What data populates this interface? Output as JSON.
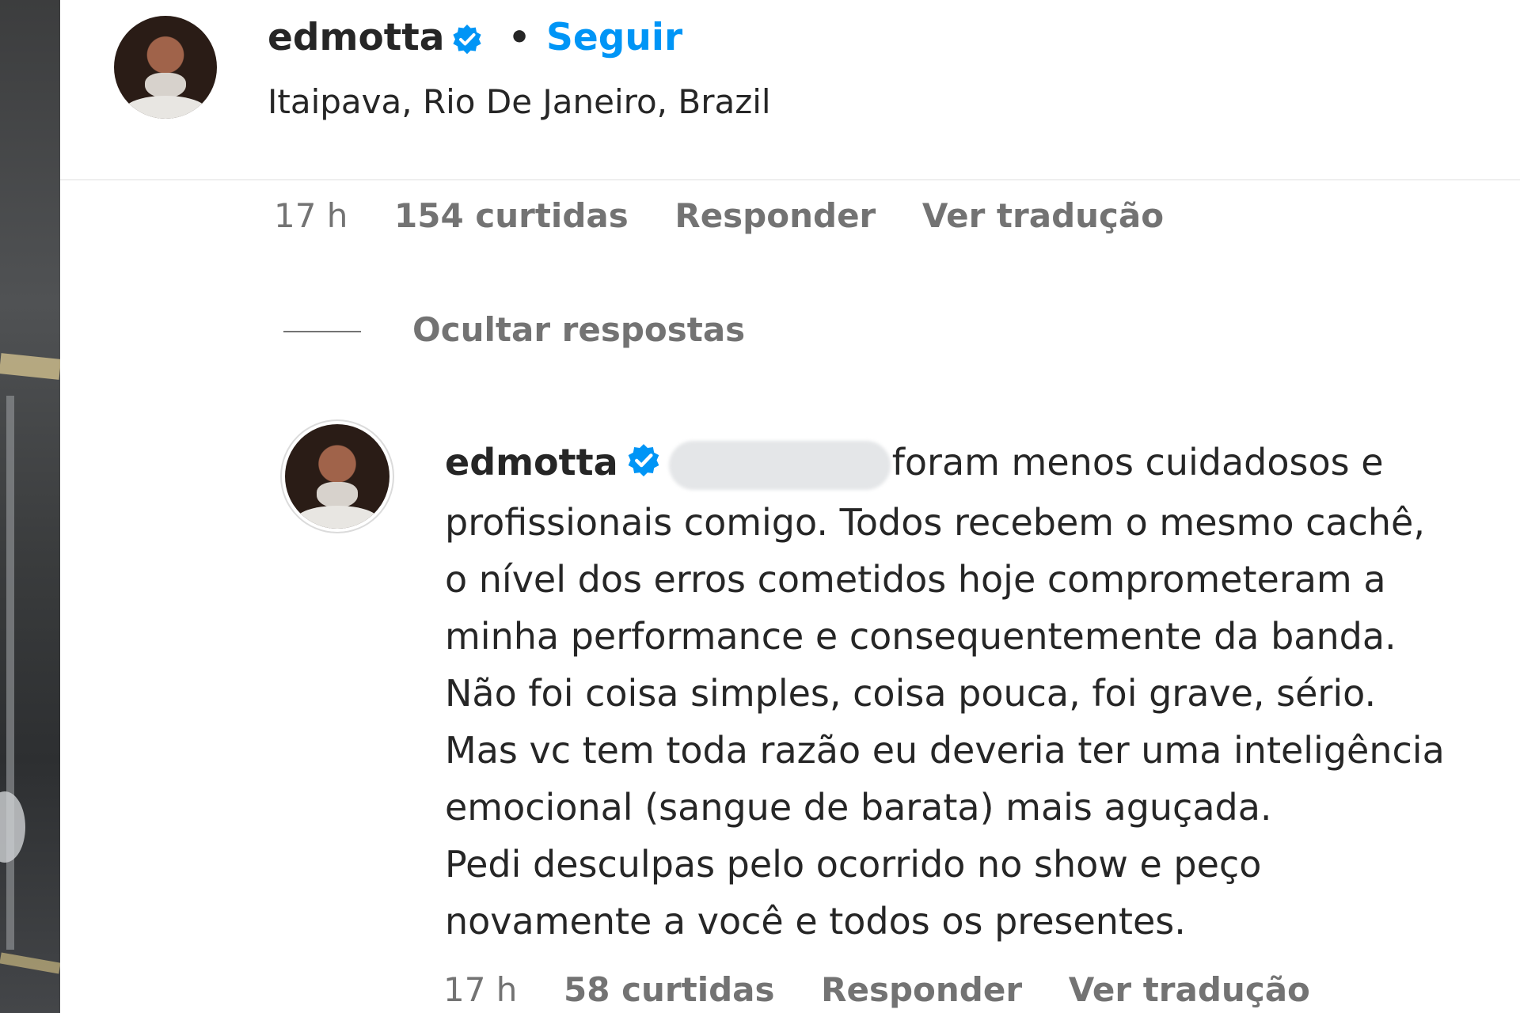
{
  "post": {
    "author": "edmotta",
    "follow_label": "Seguir",
    "separator": "•",
    "location": "Itaipava, Rio De Janeiro, Brazil"
  },
  "comment": {
    "time": "17 h",
    "likes": "154 curtidas",
    "reply_label": "Responder",
    "translate_label": "Ver tradução",
    "hide_replies_label": "Ocultar respostas"
  },
  "reply": {
    "author": "edmotta",
    "lines": [
      "foram menos cuidadosos e",
      "profissionais comigo. Todos recebem o mesmo cachê,",
      "o nível dos erros cometidos hoje comprometeram a",
      "minha performance e consequentemente da banda.",
      "Não foi coisa simples, coisa pouca, foi grave, sério.",
      "Mas vc tem toda razão eu deveria ter uma inteligência",
      "emocional (sangue de barata) mais aguçada.",
      "Pedi desculpas pelo ocorrido no show e peço",
      "novamente a você e todos os presentes."
    ],
    "time": "17 h",
    "likes": "58 curtidas",
    "reply_label": "Responder",
    "translate_label": "Ver tradução"
  },
  "icons": {
    "verified": "verified-badge-icon",
    "avatar": "profile-avatar"
  },
  "colors": {
    "link_blue": "#0095f6",
    "verified_blue": "#0095f6",
    "text": "#262626",
    "muted": "#737373"
  }
}
